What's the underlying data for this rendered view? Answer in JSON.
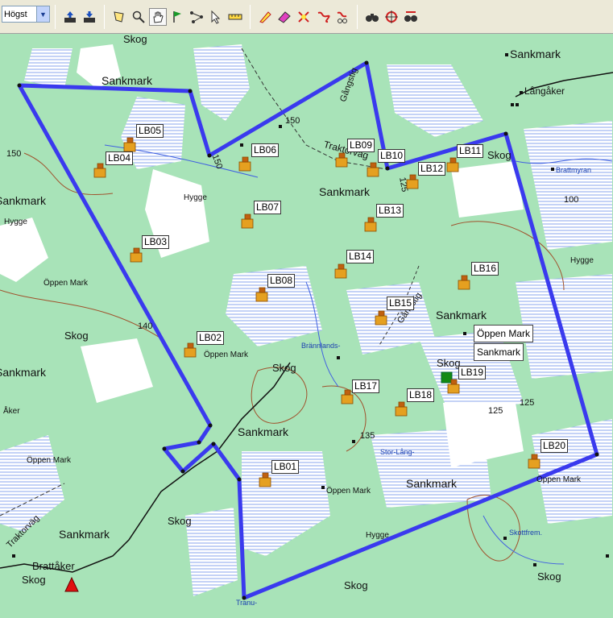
{
  "toolbar": {
    "quality_value": "Högst",
    "icons": [
      "gps-upload-icon",
      "gps-download-icon",
      "select-area-icon",
      "zoom-icon",
      "pan-hand-icon",
      "waypoint-flag-icon",
      "route-icon",
      "pointer-icon",
      "measure-icon",
      "draw-icon",
      "eraser-icon",
      "track-edit-icon",
      "route-edit-icon",
      "route-cut-icon",
      "find-icon",
      "find-near-icon",
      "find-route-icon"
    ]
  },
  "labels": {
    "skog_top": "Skog",
    "sankmark_nw": "Sankmark",
    "sankmark_ne": "Sankmark",
    "langaker": "Långåker",
    "gangstig_n": "Gångstig",
    "elev_150a": "150",
    "elev_150b": "150",
    "elev_150c": "150",
    "traktorvag_mid": "Traktorväg",
    "skog_ne": "Skog",
    "brattmyran": "Brattmyran",
    "hygge_mid": "Hygge",
    "sankmark_center": "Sankmark",
    "elev_100": "100",
    "elev_125a": "125",
    "hygge_w": "Hygge",
    "sankmark_w": "Sankmark",
    "hygge_e": "Hygge",
    "oppen_mark_w": "Öppen Mark",
    "sankmark_e": "Sankmark",
    "gangstig_mid": "Gångstig",
    "elev_140": "140",
    "skog_w": "Skog",
    "oppen_mark_mid": "Öppen Mark",
    "brannlands": "Brännlands-",
    "skog_mid": "Skog",
    "sankmark_w2": "Sankmark",
    "skog_e": "Skog",
    "elev_125b": "125",
    "elev_125c": "125",
    "aker": "Åker",
    "sankmark_s": "Sankmark",
    "elev_135": "135",
    "oppen_mark_sw": "Öppen Mark",
    "stor_lang": "Stor-Lång-",
    "oppen_mark_se": "Öppen Mark",
    "sankmark_s2": "Sankmark",
    "oppen_mark_s": "Öppen Mark",
    "traktorvag_sw": "Traktorväg",
    "skog_s": "Skog",
    "sankmark_sw": "Sankmark",
    "hygge_s": "Hygge",
    "skottfrem": "Skottfrem.",
    "brattaker": "Brattåker",
    "skog_sw": "Skog",
    "skog_se": "Skog",
    "skog_s2": "Skog",
    "tranu": "Tranu-"
  },
  "waypoints": [
    "LB01",
    "LB02",
    "LB03",
    "LB04",
    "LB05",
    "LB06",
    "LB07",
    "LB08",
    "LB09",
    "LB10",
    "LB11",
    "LB12",
    "LB13",
    "LB14",
    "LB15",
    "LB16",
    "LB17",
    "LB18",
    "LB19",
    "LB20"
  ],
  "popup": {
    "line1": "Öppen Mark",
    "line2": "Sankmark"
  },
  "colors": {
    "route": "#3a3aee",
    "forest": "#a8e3b8",
    "open": "#ffffff",
    "water": "#4060e0",
    "road": "#111111",
    "contour": "#a0522d"
  }
}
